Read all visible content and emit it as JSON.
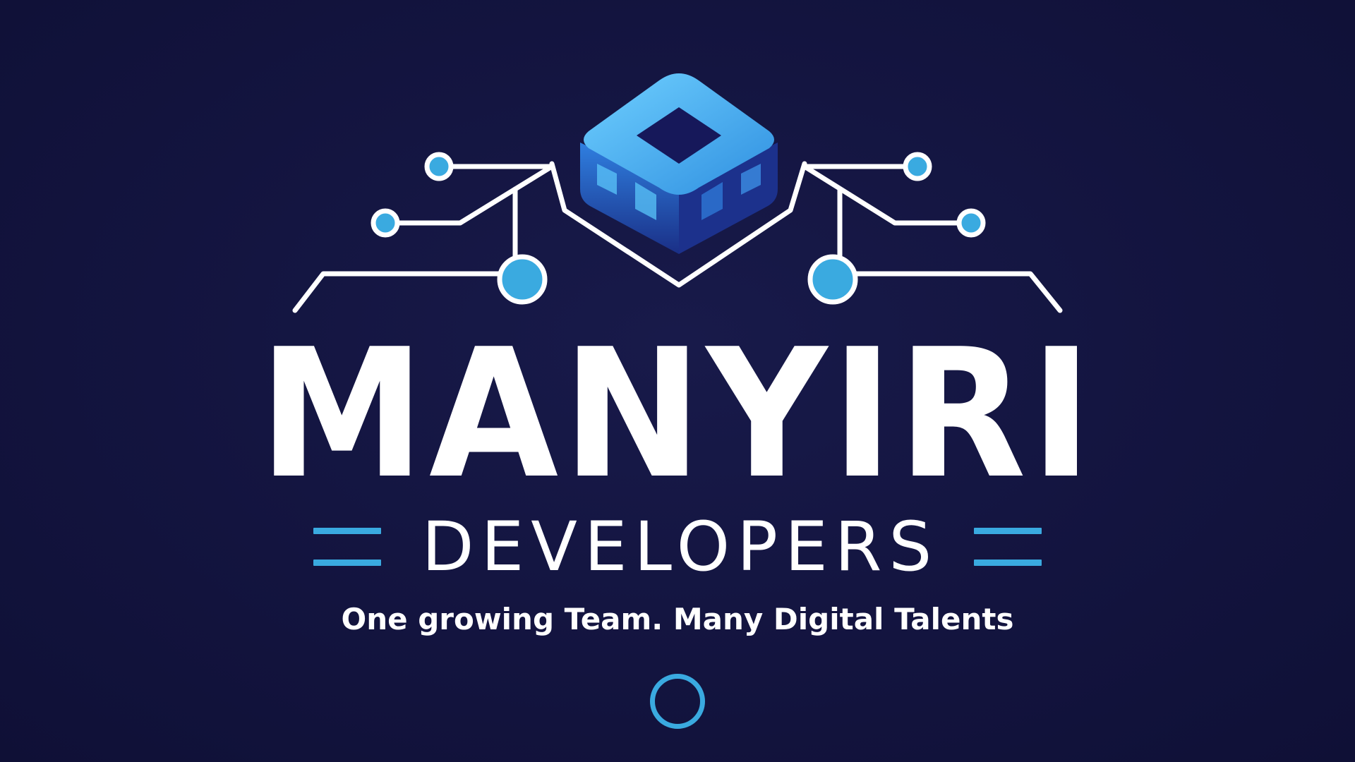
{
  "logo": {
    "name": "MANYIRI",
    "subtitle": "DEVELOPERS",
    "tagline": "One growing Team. Many Digital Talents",
    "icon": "circuit-cube-icon"
  },
  "colors": {
    "background": "#12133d",
    "accent": "#3aaae0",
    "cube_light": "#4fc3f7",
    "cube_dark": "#1d3f9b",
    "text": "#ffffff"
  }
}
